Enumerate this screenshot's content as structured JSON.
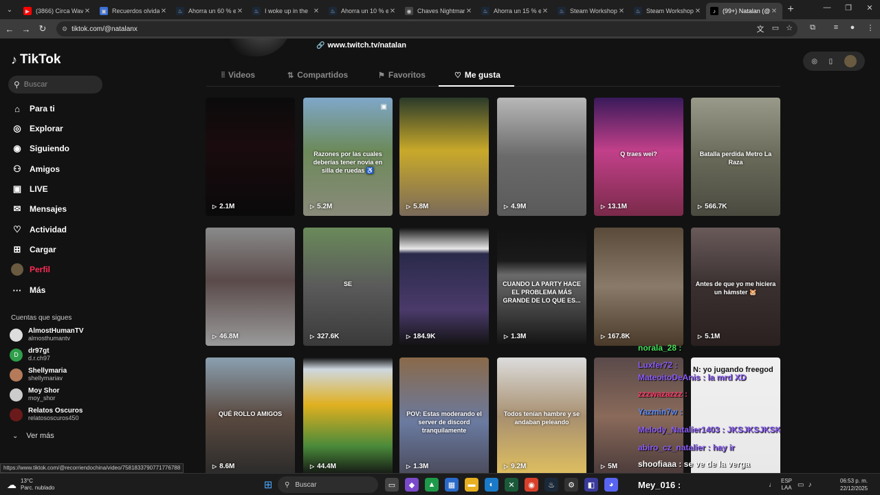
{
  "browser": {
    "tabs": [
      {
        "label": "(3866) Circa Waves",
        "fav_color": "#ff0000",
        "fav_glyph": "▶"
      },
      {
        "label": "Recuerdos olvidados",
        "fav_color": "#3b6fd6",
        "fav_glyph": "▣"
      },
      {
        "label": "Ahorra un 60 % en",
        "fav_color": "#1b2838",
        "fav_glyph": "♨"
      },
      {
        "label": "I woke up in the",
        "fav_color": "#1b2838",
        "fav_glyph": "♨"
      },
      {
        "label": "Ahorra un 10 % en",
        "fav_color": "#1b2838",
        "fav_glyph": "♨"
      },
      {
        "label": "Chaves Nightmare",
        "fav_color": "#444444",
        "fav_glyph": "◉"
      },
      {
        "label": "Ahorra un 15 % en",
        "fav_color": "#1b2838",
        "fav_glyph": "♨"
      },
      {
        "label": "Steam Workshop",
        "fav_color": "#1b2838",
        "fav_glyph": "♨"
      },
      {
        "label": "Steam Workshop",
        "fav_color": "#1b2838",
        "fav_glyph": "♨"
      },
      {
        "label": "(99+) Natalan (@n",
        "fav_color": "#000000",
        "fav_glyph": "♪"
      }
    ],
    "url": "tiktok.com/@natalanx",
    "status_url": "https://www.tiktok.com/@recorriendochina/video/7581833790771776788"
  },
  "sidebar": {
    "logo": "TikTok",
    "search_placeholder": "Buscar",
    "nav": [
      {
        "label": "Para ti",
        "icon": "home-icon",
        "glyph": "⌂"
      },
      {
        "label": "Explorar",
        "icon": "compass-icon",
        "glyph": "◎"
      },
      {
        "label": "Siguiendo",
        "icon": "following-icon",
        "glyph": "◉"
      },
      {
        "label": "Amigos",
        "icon": "friends-icon",
        "glyph": "⚇"
      },
      {
        "label": "LIVE",
        "icon": "live-icon",
        "glyph": "▣"
      },
      {
        "label": "Mensajes",
        "icon": "messages-icon",
        "glyph": "✉",
        "badge": "99+"
      },
      {
        "label": "Actividad",
        "icon": "activity-icon",
        "glyph": "♡",
        "badge": "99+"
      },
      {
        "label": "Cargar",
        "icon": "upload-icon",
        "glyph": "⊞"
      },
      {
        "label": "Perfil",
        "icon": "profile-icon",
        "glyph": "●"
      },
      {
        "label": "Más",
        "icon": "more-icon",
        "glyph": "···"
      }
    ],
    "following_title": "Cuentas que sigues",
    "accounts": [
      {
        "name": "AlmostHumanTV",
        "handle": "almosthumantv",
        "color": "#dddddd",
        "letter": ""
      },
      {
        "name": "dr97gt",
        "handle": "d.r.ch97",
        "color": "#2e9e4a",
        "letter": "D"
      },
      {
        "name": "Shellymaria",
        "handle": "shellymariav",
        "color": "#b57a5a",
        "letter": ""
      },
      {
        "name": "Moy Shor",
        "handle": "moy_shor",
        "color": "#cccccc",
        "letter": ""
      },
      {
        "name": "Relatos Oscuros",
        "handle": "relatososcuros450",
        "color": "#6a1a1a",
        "letter": ""
      }
    ],
    "see_more": "Ver más"
  },
  "profile": {
    "link": "www.twitch.tv/natalan",
    "tabs": [
      {
        "label": "Videos",
        "icon": "grid-icon",
        "glyph": "⦙⦙"
      },
      {
        "label": "Compartidos",
        "icon": "repost-icon",
        "glyph": "⇅"
      },
      {
        "label": "Favoritos",
        "icon": "bookmark-icon",
        "glyph": "⚑"
      },
      {
        "label": "Me gusta",
        "icon": "heart-icon",
        "glyph": "♡"
      }
    ]
  },
  "videos": [
    {
      "views": "2.1M",
      "caption": "",
      "bg": "linear-gradient(180deg,#0b0b0b 0%,#1a0b0e 40%,#0a0a0a 100%)"
    },
    {
      "views": "5.2M",
      "caption": "Razones por las cuales deberías tener novia en silla de ruedas ♿",
      "bg": "linear-gradient(180deg,#7fa7c9 0%,#6c8a5a 45%,#8a8a7a 100%)",
      "multi": true
    },
    {
      "views": "5.8M",
      "caption": "",
      "bg": "linear-gradient(180deg,#2a3a2a 0%,#c9a92a 45%,#7a6a5a 100%)"
    },
    {
      "views": "4.9M",
      "caption": "",
      "bg": "linear-gradient(180deg,#b8b8b8 0%,#6a6a6a 50%,#5a5a5a 100%)"
    },
    {
      "views": "13.1M",
      "caption": "Q traes wei?",
      "bg": "linear-gradient(180deg,#3a1a5a 0%,#c2408a 45%,#7a2a4a 100%)"
    },
    {
      "views": "566.7K",
      "caption": "Batalla perdida Metro La Raza",
      "bg": "linear-gradient(180deg,#9a9a8a 0%,#6a6a5a 50%,#4a4a40 100%)"
    },
    {
      "views": "46.8M",
      "caption": "",
      "bg": "linear-gradient(180deg,#8a8a8a 0%,#5a4a4a 45%,#9a9a9a 100%)"
    },
    {
      "views": "327.6K",
      "caption": "SE",
      "bg": "linear-gradient(180deg,#6a8a5a 0%,#5a5a5a 50%,#3a3a3a 100%)"
    },
    {
      "views": "184.9K",
      "caption": "",
      "bg": "linear-gradient(180deg,#121212 0%,#e8e8e8 18%,#2a2a4a 22%,#4a3a6a 70%,#121212 100%)"
    },
    {
      "views": "1.3M",
      "caption": "CUANDO LA PARTY HACE EL PROBLEMA MÁS GRANDE DE LO QUE ES...",
      "bg": "linear-gradient(180deg,#121212 0%,#1a1a1a 28%,#6a6a6a 40%,#3a3a3a 75%,#121212 100%)"
    },
    {
      "views": "167.8K",
      "caption": "",
      "bg": "linear-gradient(180deg,#5a4a3a 0%,#8a7a6a 50%,#4a3a2a 100%)"
    },
    {
      "views": "5.1M",
      "caption": "Antes de que yo me hiciera un hámster 🐹",
      "bg": "linear-gradient(180deg,#6a5a5a 0%,#3a3030 50%,#2a2020 100%)"
    },
    {
      "views": "8.6M",
      "caption": "QUÉ ROLLO AMIGOS",
      "bg": "linear-gradient(180deg,#8aa0b0 0%,#5a4a40 50%,#2a2a2a 100%)"
    },
    {
      "views": "44.4M",
      "caption": "",
      "bg": "linear-gradient(180deg,#121212 0%,#cfd8e0 10%,#e0b020 40%,#4a8a3a 75%,#121212 100%)"
    },
    {
      "views": "1.3M",
      "caption": "POV: Estas moderando el server de discord tranquilamente",
      "bg": "linear-gradient(180deg,#8a6a4a 0%,#6a7aa0 55%,#4a4a5a 100%)"
    },
    {
      "views": "9.2M",
      "caption": "Todos tenían hambre y se andaban peleando",
      "bg": "linear-gradient(180deg,#dcdcdc 0%,#a89070 50%,#e0c060 100%)"
    },
    {
      "views": "5M",
      "caption": "",
      "bg": "linear-gradient(180deg,#5a4a4a 0%,#8a6a5a 50%,#4a3a3a 100%)"
    },
    {
      "views": "",
      "caption": "",
      "bg": "linear-gradient(180deg,#f0f0f0 0%,#e8e8e8 100%)"
    }
  ],
  "chat": [
    {
      "text": "norala_28 :",
      "color": "#46e05a"
    },
    {
      "text": "Luxfer72 :",
      "color": "#8a5cf5"
    },
    {
      "text": "MateoitoDeAnis : la mrd XD",
      "color": "#8a5cf5"
    },
    {
      "text": "zzzwazazzz :",
      "color": "#ff3a6a"
    },
    {
      "text": "Yazmin7w :",
      "color": "#5a8af5"
    },
    {
      "text": "Melody_Natalier1403 : JKSJKSJKSK",
      "color": "#8a5cf5"
    },
    {
      "text": "abiro_cz_natalier : hay ir",
      "color": "#8a5cf5"
    },
    {
      "text": "shoofiaaa : se ve de la verga",
      "color": "#ffffff"
    },
    {
      "text": "Mey_016 :",
      "color": "#ffffff"
    },
    {
      "text": "N: yo jugando freegod",
      "color": "#111111"
    }
  ],
  "taskbar": {
    "temp": "13°C",
    "weather": "Parc. nublado",
    "search": "Buscar",
    "lang1": "ESP",
    "lang2": "LAA",
    "time": "06:53 p. m.",
    "date": "22/12/2025"
  }
}
